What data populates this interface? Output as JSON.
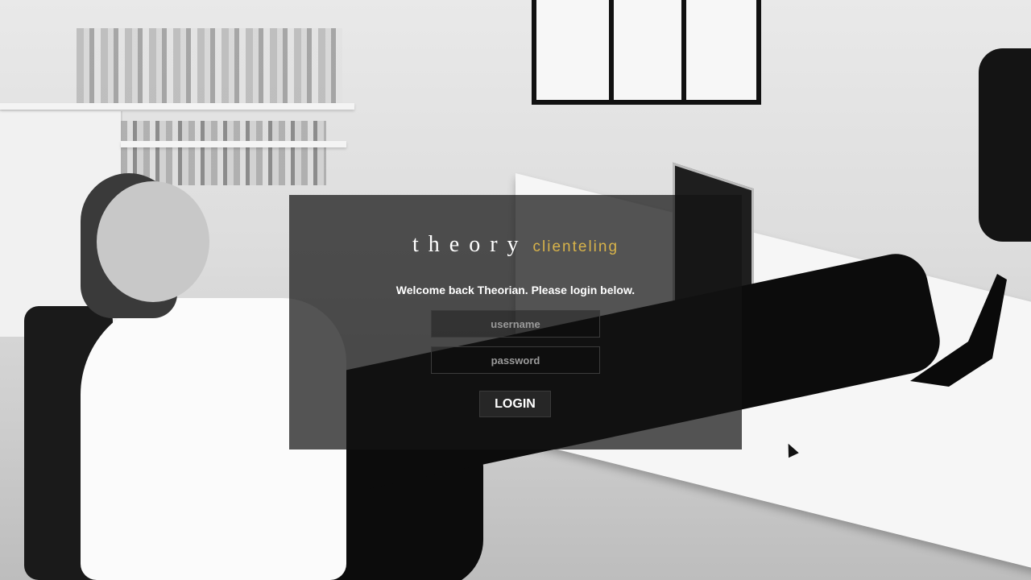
{
  "background": {
    "icon": "office-photo"
  },
  "brand": {
    "name": "theory",
    "product": "clienteling",
    "accent_color": "#d8b34a"
  },
  "login": {
    "welcome_text": "Welcome back Theorian. Please login below.",
    "username_placeholder": "username",
    "username_value": "",
    "password_placeholder": "password",
    "password_value": "",
    "submit_label": "LOGIN"
  },
  "cursor": {
    "icon": "mouse-pointer-icon"
  }
}
